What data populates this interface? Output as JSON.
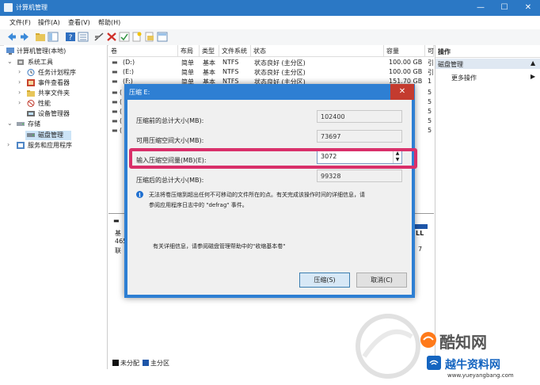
{
  "window": {
    "title": "计算机管理"
  },
  "menu": [
    "文件(F)",
    "操作(A)",
    "查看(V)",
    "帮助(H)"
  ],
  "tree": {
    "root": "计算机管理(本地)",
    "system_tools": "系统工具",
    "task_scheduler": "任务计划程序",
    "event_viewer": "事件查看器",
    "shared_folders": "共享文件夹",
    "performance": "性能",
    "device_manager": "设备管理器",
    "storage": "存储",
    "disk_management": "磁盘管理",
    "services": "服务和应用程序"
  },
  "volume_table": {
    "headers": [
      "卷",
      "布局",
      "类型",
      "文件系统",
      "状态",
      "容量",
      "可"
    ],
    "rows": [
      {
        "vol": "(D:)",
        "layout": "简单",
        "type": "基本",
        "fs": "NTFS",
        "status": "状态良好 (主分区)",
        "capacity": "100.00 GB",
        "free": "引"
      },
      {
        "vol": "(E:)",
        "layout": "简单",
        "type": "基本",
        "fs": "NTFS",
        "status": "状态良好 (主分区)",
        "capacity": "100.00 GB",
        "free": "引"
      },
      {
        "vol": "(F:)",
        "layout": "简单",
        "type": "基本",
        "fs": "NTFS",
        "status": "状态良好 (主分区)",
        "capacity": "151.70 GB",
        "free": "1"
      }
    ],
    "partial_rows": [
      "(",
      "(",
      "(",
      "(",
      "(",
      "("
    ],
    "partial_right": [
      "5",
      "5",
      "5",
      "5",
      "5"
    ]
  },
  "disk_panel": {
    "line1": "基",
    "line2": "465",
    "line3": "联",
    "right1": "",
    "right2": "LL",
    "right3": "7"
  },
  "legend": {
    "unallocated": "未分配",
    "primary": "主分区"
  },
  "actions": {
    "header": "操作",
    "section": "磁盘管理",
    "more": "更多操作"
  },
  "dialog": {
    "title": "压缩 E:",
    "total_before_label": "压缩前的总计大小(MB):",
    "total_before_value": "102400",
    "available_label": "可用压缩空间大小(MB):",
    "available_value": "73697",
    "input_label": "输入压缩空间量(MB)(E):",
    "input_value": "3072",
    "total_after_label": "压缩后的总计大小(MB):",
    "total_after_value": "99328",
    "info_text_1": "无法将卷压缩到超出任何不可移动的文件所在的点。有关完成该操作时间的详细信息，请",
    "info_text_2": "参阅应用程序日志中的 \"defrag\" 事件。",
    "help_text": "有关详细信息，请参阅磁盘管理帮助中的\"收缩基本卷\"",
    "shrink_button": "压缩(S)",
    "cancel_button": "取消(C)"
  },
  "watermark": {
    "brand1": "酷知网",
    "brand2": "越牛资料网",
    "url": "www.yueyangbang.com"
  },
  "colors": {
    "titlebar": "#2b78c5",
    "dialog_frame": "#2e7fd3",
    "highlight": "#d9306a",
    "selection": "#cce4f7"
  }
}
